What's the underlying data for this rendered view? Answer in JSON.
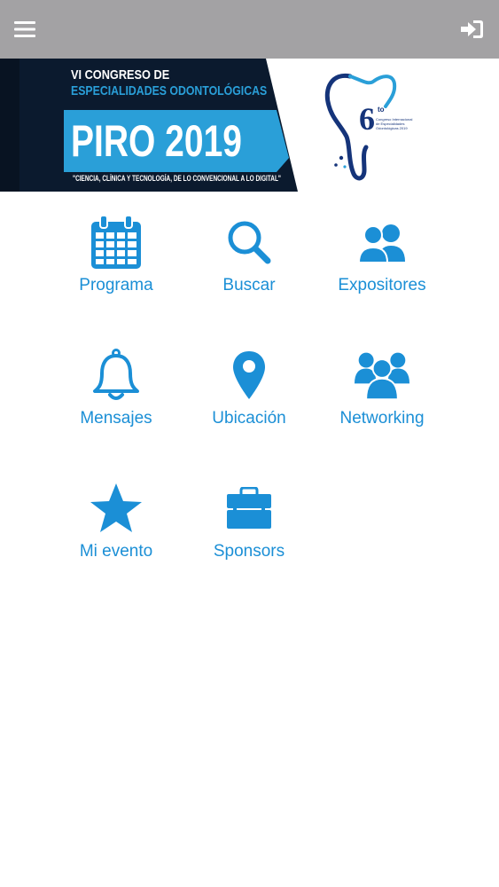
{
  "header": {
    "menu_icon": "hamburger-menu-icon",
    "login_icon": "sign-in-icon",
    "background": "#a3a2a4"
  },
  "banner": {
    "line1": "VI CONGRESO DE",
    "line2": "ESPECIALIDADES ODONTOLÓGICAS",
    "title": "PIRO 2019",
    "tagline": "\"CIENCIA, CLÍNICA Y TECNOLOGÍA, DE LO CONVENCIONAL A LO DIGITAL\"",
    "badge_number": "6",
    "badge_suffix": "to",
    "badge_caption": "Congreso Internacional de Especialidades Odontológicas 2019",
    "colors": {
      "dark": "#0b1a2e",
      "accent": "#2a9fd8",
      "badge": "#15347a"
    }
  },
  "menu": {
    "accent": "#1b8fd6",
    "items": [
      {
        "label": "Programa",
        "icon": "calendar-icon"
      },
      {
        "label": "Buscar",
        "icon": "search-icon"
      },
      {
        "label": "Expositores",
        "icon": "users-icon"
      },
      {
        "label": "Mensajes",
        "icon": "bell-icon"
      },
      {
        "label": "Ubicación",
        "icon": "map-marker-icon"
      },
      {
        "label": "Networking",
        "icon": "group-icon"
      },
      {
        "label": "Mi evento",
        "icon": "star-icon"
      },
      {
        "label": "Sponsors",
        "icon": "briefcase-icon"
      }
    ]
  }
}
